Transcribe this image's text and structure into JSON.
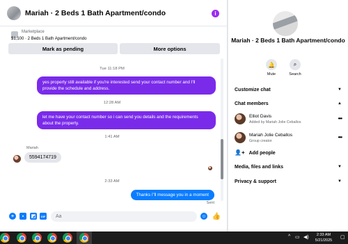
{
  "chat": {
    "title": "Mariah · 2 Beds 1 Bath Apartment/condo",
    "marketplace_label": "Marketplace",
    "listing": "$1,100 · 2 Beds 1 Bath Apartment/condo",
    "mark_pending": "Mark as pending",
    "more_options": "More options",
    "cut_text": "... ... ... ... ... ... ... ... ...",
    "messages": [
      {
        "time": "Tue 11:18 PM"
      },
      {
        "text": "yes property still available if you're interested send your contact number and I'll provide the schedule and address."
      },
      {
        "time": "12:28 AM"
      },
      {
        "text": "let me have your contact number so i can send you details and the requirements about the property."
      },
      {
        "time": "1:41 AM"
      },
      {
        "sender": "Mariah",
        "text": "5594174719"
      },
      {
        "time": "2:33 AM"
      },
      {
        "text": "Thanks i\"ll message you in a moment",
        "status": "Sent"
      }
    ],
    "composer_placeholder": "Aa"
  },
  "panel": {
    "name": "Mariah · 2 Beds 1 Bath Apartment/condo",
    "mute": "Mute",
    "search": "Search",
    "customize": "Customize chat",
    "members_header": "Chat members",
    "members": [
      {
        "name": "Elliot Davis",
        "sub": "Added by Mariah Jolie Ceballos"
      },
      {
        "name": "Mariah Jolie Ceballos",
        "sub": "Group creator"
      }
    ],
    "add_people": "Add people",
    "media": "Media, files and links",
    "privacy": "Privacy & support"
  },
  "taskbar": {
    "time": "2:33 AM",
    "date": "5/21/2025"
  },
  "colors": {
    "accent_purple": "#7a2bea",
    "accent_blue": "#0a7cff",
    "info": "#9b2cf2"
  }
}
